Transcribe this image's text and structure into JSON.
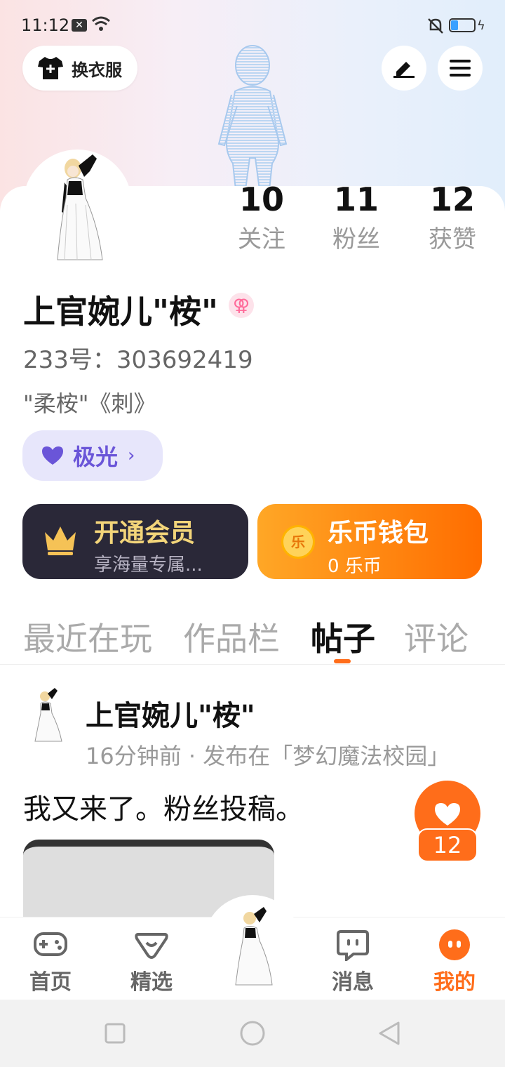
{
  "status_bar": {
    "time": "11:12",
    "notif_badge": "✕"
  },
  "header": {
    "outfit_label": "换衣服"
  },
  "stats": [
    {
      "num": "10",
      "label": "关注"
    },
    {
      "num": "11",
      "label": "粉丝"
    },
    {
      "num": "12",
      "label": "获赞"
    }
  ],
  "profile": {
    "name": "上官婉儿\"桉\"",
    "gender_symbol": "⚢",
    "id_text": "233号：303692419",
    "bio": "\"柔桉\"《刺》",
    "aurora_label": "极光",
    "aurora_chevron": "›"
  },
  "vip": {
    "title": "开通会员",
    "subtitle": "享海量专属..."
  },
  "wallet": {
    "title": "乐币钱包",
    "balance": "0 乐币",
    "coin_char": "乐"
  },
  "tabs": [
    "最近在玩",
    "作品栏",
    "帖子",
    "评论"
  ],
  "active_tab": "帖子",
  "post": {
    "author": "上官婉儿\"桉\"",
    "meta": "16分钟前 · 发布在「梦幻魔法校园」",
    "text": "我又来了。粉丝投稿。",
    "likes": "12"
  },
  "bottom_nav": [
    {
      "label": "首页",
      "icon": "gamepad-icon"
    },
    {
      "label": "精选",
      "icon": "heart-chat-icon"
    },
    {
      "label": "消息",
      "icon": "chat-icon"
    },
    {
      "label": "我的",
      "icon": "smile-icon"
    }
  ],
  "colors": {
    "accent": "#ff6d1a",
    "vip_gold": "#f3d57a",
    "aurora": "#6a55d8"
  }
}
